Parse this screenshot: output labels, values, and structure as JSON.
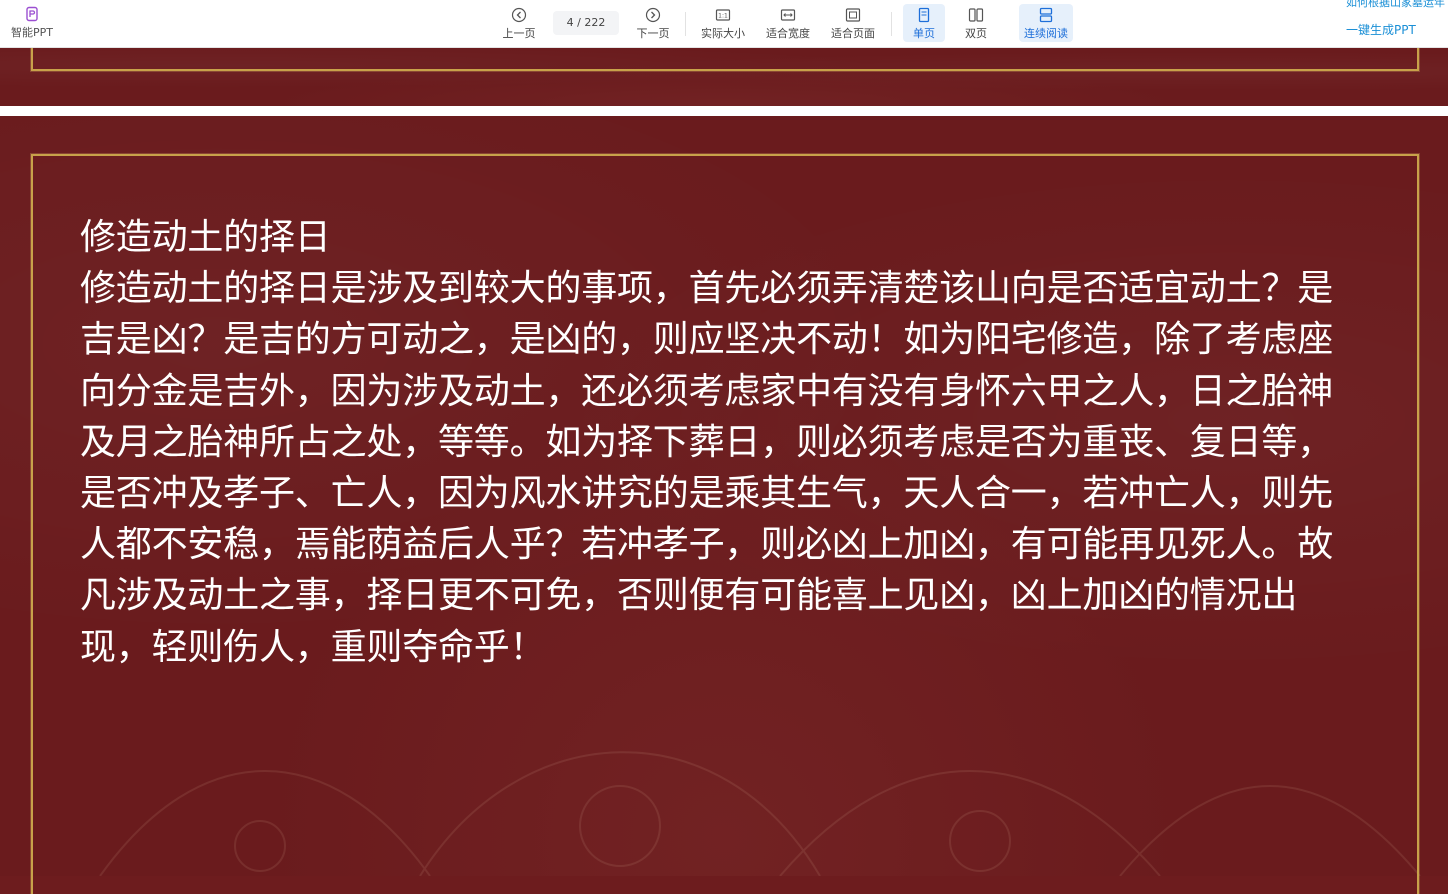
{
  "toolbar": {
    "smart_ppt": "智能PPT",
    "prev_page": "上一页",
    "page_indicator": "4 / 222",
    "next_page": "下一页",
    "actual_size": "实际大小",
    "fit_width": "适合宽度",
    "fit_page": "适合页面",
    "single_page": "单页",
    "double_page": "双页",
    "continuous": "连续阅读",
    "right_link_top": "如何根据山家墓运年",
    "right_link": "一键生成PPT",
    "accent_color": "#1e6fd9",
    "link_color": "#1a8fd6"
  },
  "slide": {
    "title": "修造动土的择日",
    "body": "修造动土的择日是涉及到较大的事项，首先必须弄清楚该山向是否适宜动土？是吉是凶？是吉的方可动之，是凶的，则应坚决不动！如为阳宅修造，除了考虑座向分金是吉外，因为涉及动土，还必须考虑家中有没有身怀六甲之人，日之胎神及月之胎神所占之处，等等。如为择下葬日，则必须考虑是否为重丧、复日等，是否冲及孝子、亡人，因为风水讲究的是乘其生气，天人合一，若冲亡人，则先人都不安稳，焉能荫益后人乎？若冲孝子，则必凶上加凶，有可能再见死人。故凡涉及动土之事，择日更不可免，否则便有可能喜上见凶，凶上加凶的情况出现，轻则伤人，重则夺命乎！",
    "background_color": "#6a1b1d",
    "frame_color": "#c8a24a"
  }
}
